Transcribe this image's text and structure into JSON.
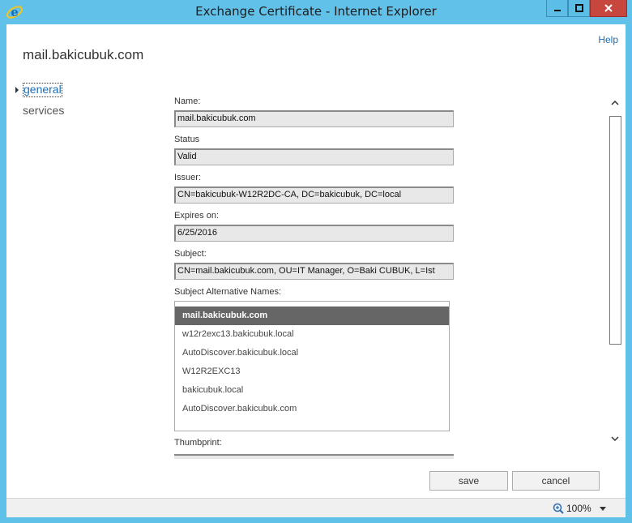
{
  "window": {
    "title": "Exchange Certificate - Internet Explorer"
  },
  "page": {
    "help": "Help",
    "title": "mail.bakicubuk.com"
  },
  "nav": {
    "items": [
      {
        "label": "general"
      },
      {
        "label": "services"
      }
    ]
  },
  "fields": {
    "name": {
      "label": "Name:",
      "value": "mail.bakicubuk.com"
    },
    "status": {
      "label": "Status",
      "value": "Valid"
    },
    "issuer": {
      "label": "Issuer:",
      "value": "CN=bakicubuk-W12R2DC-CA, DC=bakicubuk, DC=local"
    },
    "expires": {
      "label": "Expires on:",
      "value": "6/25/2016"
    },
    "subject": {
      "label": "Subject:",
      "value": "CN=mail.bakicubuk.com, OU=IT Manager, O=Baki CUBUK, L=Ist"
    },
    "san": {
      "label": "Subject Alternative Names:",
      "items": [
        "mail.bakicubuk.com",
        "w12r2exc13.bakicubuk.local",
        "AutoDiscover.bakicubuk.local",
        "W12R2EXC13",
        "bakicubuk.local",
        "AutoDiscover.bakicubuk.com"
      ]
    },
    "thumbprint": {
      "label": "Thumbprint:"
    }
  },
  "buttons": {
    "save": "save",
    "cancel": "cancel"
  },
  "statusbar": {
    "zoom": "100%"
  },
  "colors": {
    "titlebar": "#62c1e9",
    "link": "#1c6db5",
    "selected_row": "#666666",
    "close_button": "#c7463e"
  },
  "icons": [
    "ie-logo-icon",
    "minimize-icon",
    "maximize-icon",
    "close-icon",
    "nav-arrow-icon",
    "scroll-up-icon",
    "scroll-down-icon",
    "zoom-icon",
    "dropdown-icon"
  ]
}
